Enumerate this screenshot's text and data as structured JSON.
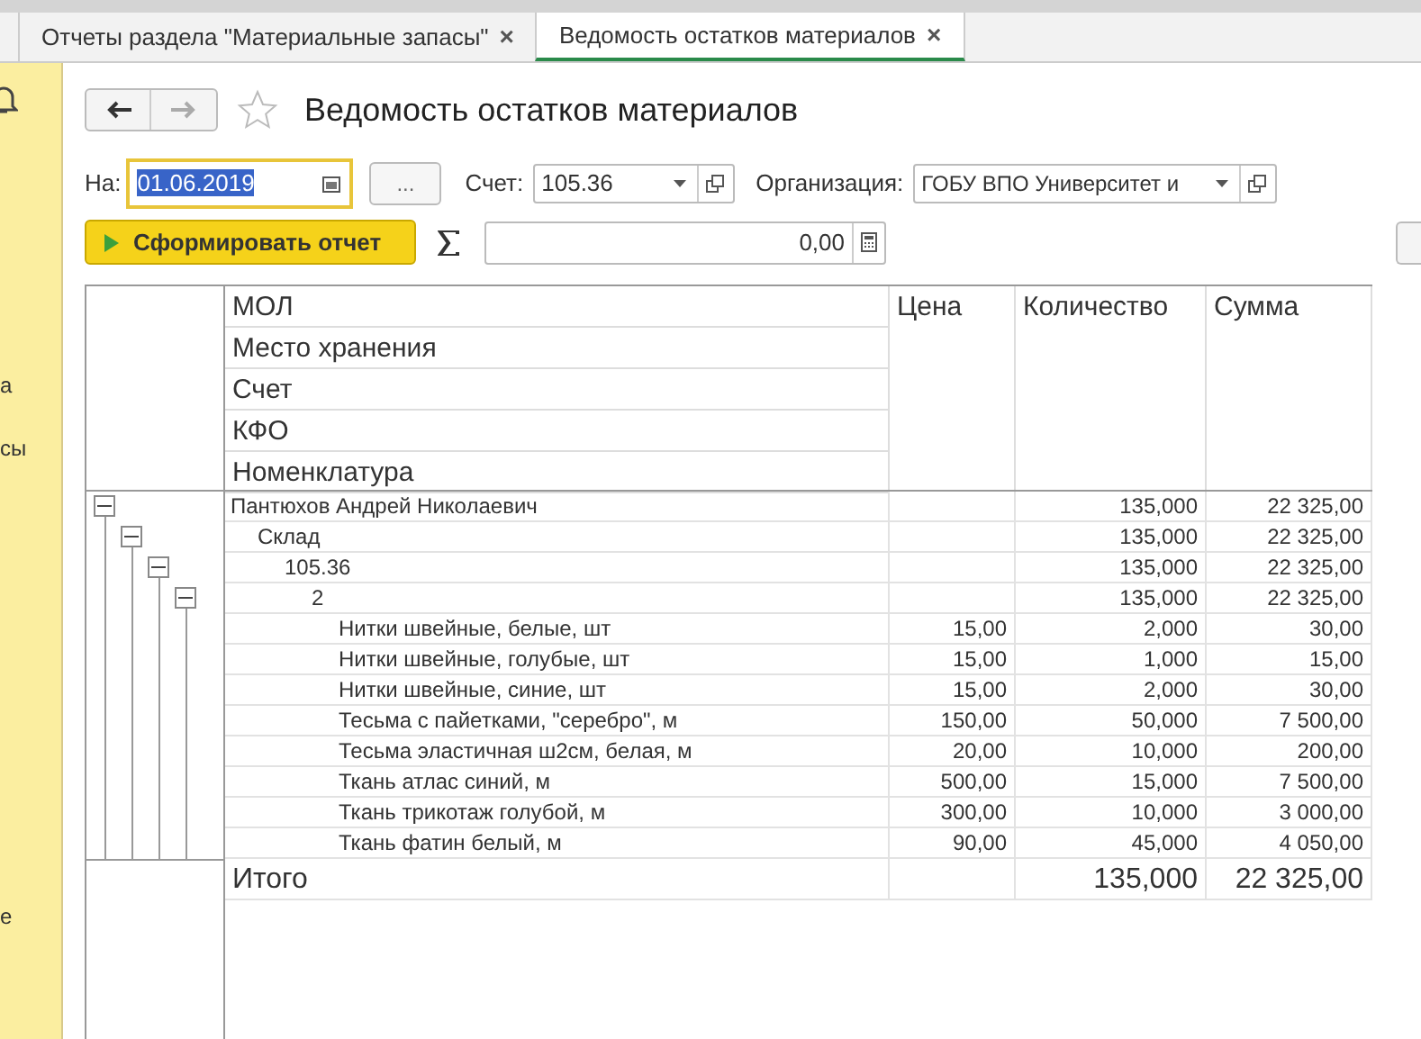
{
  "tabs": [
    {
      "label": "Отчеты раздела \"Материальные запасы\"",
      "close": "×",
      "selected": false
    },
    {
      "label": "Ведомость остатков материалов",
      "close": "×",
      "selected": true
    }
  ],
  "sidebar": {
    "items": [
      "а",
      "сы",
      "е"
    ]
  },
  "title": "Ведомость остатков материалов",
  "filters": {
    "date_label": "На:",
    "date_value": "01.06.2019",
    "more_button": "...",
    "account_label": "Счет:",
    "account_value": "105.36",
    "org_label": "Организация:",
    "org_value": "ГОБУ ВПО Университет и"
  },
  "generate_button": "Сформировать отчет",
  "sum_field": "0,00",
  "table": {
    "group_headers": [
      "МОЛ",
      "Место хранения",
      "Счет",
      "КФО",
      "Номенклатура"
    ],
    "columns": [
      "Цена",
      "Количество",
      "Сумма"
    ],
    "rows": [
      {
        "name": "Пантюхов Андрей Николаевич",
        "qty": "135,000",
        "sum": "22 325,00",
        "expanded": true,
        "children": [
          {
            "name": "Склад",
            "qty": "135,000",
            "sum": "22 325,00",
            "expanded": true,
            "children": [
              {
                "name": "105.36",
                "qty": "135,000",
                "sum": "22 325,00",
                "expanded": true,
                "children": [
                  {
                    "name": "2",
                    "qty": "135,000",
                    "sum": "22 325,00",
                    "expanded": true,
                    "children": [
                      {
                        "name": "Нитки швейные, белые, шт",
                        "price": "15,00",
                        "qty": "2,000",
                        "sum": "30,00"
                      },
                      {
                        "name": "Нитки швейные, голубые, шт",
                        "price": "15,00",
                        "qty": "1,000",
                        "sum": "15,00"
                      },
                      {
                        "name": "Нитки швейные, синие, шт",
                        "price": "15,00",
                        "qty": "2,000",
                        "sum": "30,00"
                      },
                      {
                        "name": "Тесьма с пайетками, \"серебро\", м",
                        "price": "150,00",
                        "qty": "50,000",
                        "sum": "7 500,00"
                      },
                      {
                        "name": "Тесьма эластичная ш2см, белая, м",
                        "price": "20,00",
                        "qty": "10,000",
                        "sum": "200,00"
                      },
                      {
                        "name": "Ткань атлас синий, м",
                        "price": "500,00",
                        "qty": "15,000",
                        "sum": "7 500,00"
                      },
                      {
                        "name": "Ткань трикотаж голубой, м",
                        "price": "300,00",
                        "qty": "10,000",
                        "sum": "3 000,00"
                      },
                      {
                        "name": "Ткань фатин белый, м",
                        "price": "90,00",
                        "qty": "45,000",
                        "sum": "4 050,00"
                      }
                    ]
                  }
                ]
              }
            ]
          }
        ]
      }
    ],
    "total": {
      "label": "Итого",
      "qty": "135,000",
      "sum": "22 325,00"
    }
  }
}
